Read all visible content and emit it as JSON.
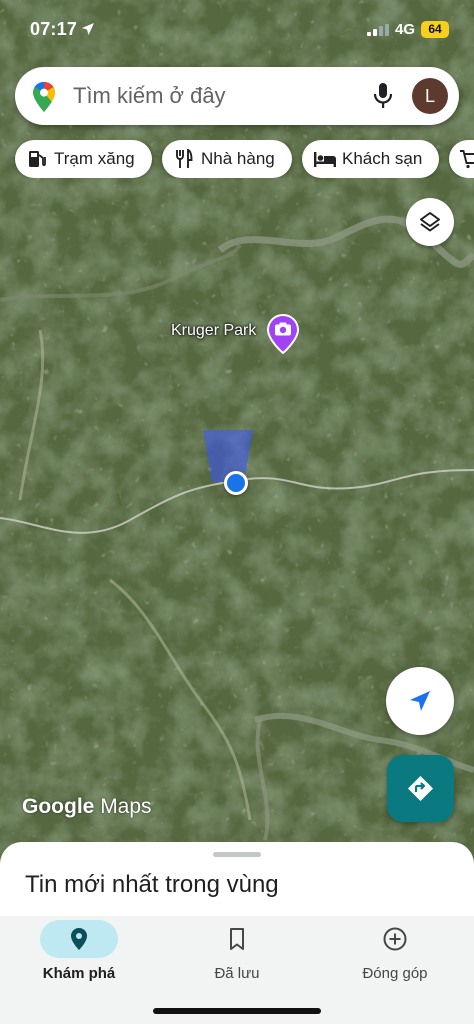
{
  "status_bar": {
    "time": "07:17",
    "network": "4G",
    "battery": "64"
  },
  "search": {
    "placeholder": "Tìm kiếm ở đây",
    "avatar_letter": "L"
  },
  "chips": [
    {
      "label": "Trạm xăng",
      "icon": "gas-station-icon"
    },
    {
      "label": "Nhà hàng",
      "icon": "restaurant-icon"
    },
    {
      "label": "Khách sạn",
      "icon": "hotel-icon"
    },
    {
      "label": "",
      "icon": "shopping-cart-icon"
    }
  ],
  "map": {
    "poi": {
      "name": "Kruger Park",
      "icon": "camera-icon",
      "color": "#a142f4"
    },
    "watermark": {
      "brand": "Google",
      "product": "Maps"
    }
  },
  "sheet": {
    "title": "Tin mới nhất trong vùng"
  },
  "nav": {
    "items": [
      {
        "label": "Khám phá",
        "icon": "explore-pin-icon",
        "active": true
      },
      {
        "label": "Đã lưu",
        "icon": "bookmark-icon",
        "active": false
      },
      {
        "label": "Đóng góp",
        "icon": "add-circle-icon",
        "active": false
      }
    ]
  },
  "colors": {
    "accent": "#1a73e8",
    "directions": "#0b7a80",
    "nav_active_pill": "#bfe9f2"
  }
}
